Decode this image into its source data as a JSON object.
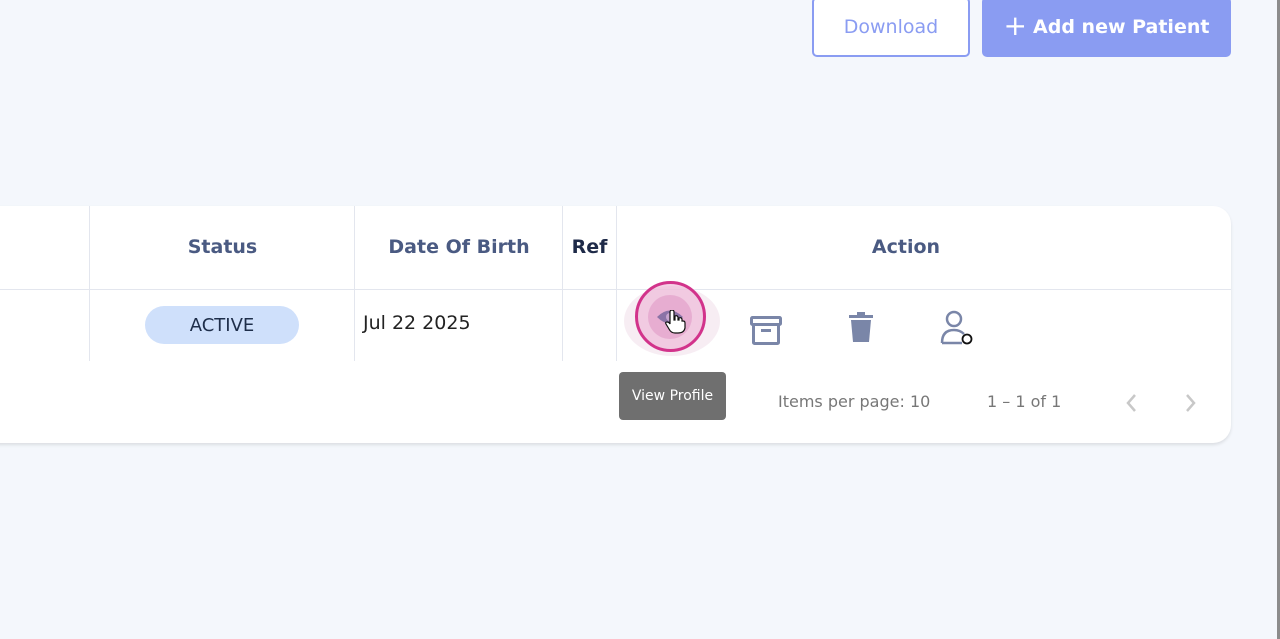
{
  "toolbar": {
    "download_label": "Download",
    "add_plus": "+",
    "add_label": "Add new Patient"
  },
  "table": {
    "columns": [
      "Status",
      "Date Of Birth",
      "Ref",
      "Action"
    ],
    "rows": [
      {
        "status": "ACTIVE",
        "date_of_birth": "Jul 22 2025",
        "ref": ""
      }
    ],
    "actions": [
      "eye-icon",
      "archive-icon",
      "trash-icon",
      "user-status-icon"
    ]
  },
  "tooltip": {
    "text": "View Profile"
  },
  "paginator": {
    "items_per_page": "Items per page: 10",
    "range": "1 – 1 of 1",
    "prev_icon": "chevron-left-icon",
    "next_icon": "chevron-right-icon"
  },
  "colors": {
    "accent": "#8a9cf2",
    "header_text": "#4a5a82",
    "badge_bg": "#cfe0fb",
    "icon": "#7a86a8",
    "highlight": "#d2338b",
    "background": "#f4f7fc"
  }
}
